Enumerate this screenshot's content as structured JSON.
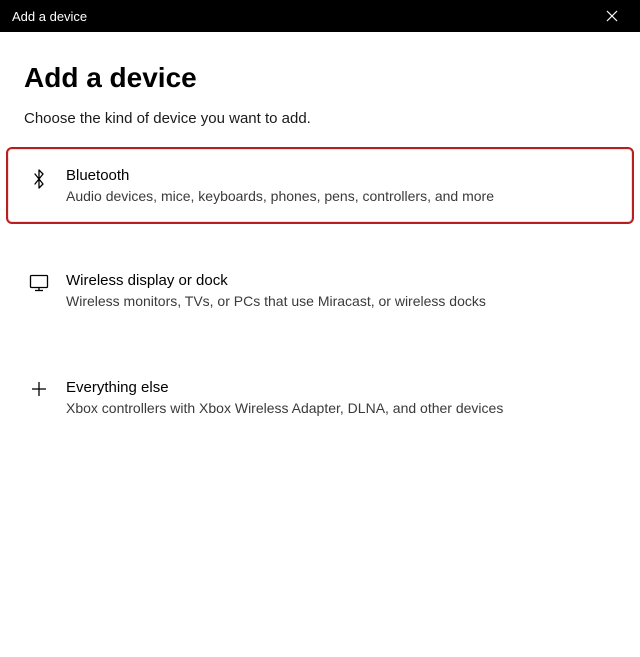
{
  "titlebar": {
    "title": "Add a device"
  },
  "page": {
    "heading": "Add a device",
    "subheading": "Choose the kind of device you want to add."
  },
  "options": [
    {
      "id": "bluetooth",
      "title": "Bluetooth",
      "description": "Audio devices, mice, keyboards, phones, pens, controllers, and more",
      "highlighted": true,
      "icon": "bluetooth-icon"
    },
    {
      "id": "wireless-display",
      "title": "Wireless display or dock",
      "description": "Wireless monitors, TVs, or PCs that use Miracast, or wireless docks",
      "highlighted": false,
      "icon": "display-icon"
    },
    {
      "id": "everything-else",
      "title": "Everything else",
      "description": "Xbox controllers with Xbox Wireless Adapter, DLNA, and other devices",
      "highlighted": false,
      "icon": "plus-icon"
    }
  ],
  "colors": {
    "highlight_border": "#b81e1e",
    "titlebar_bg": "#000000",
    "titlebar_fg": "#ffffff"
  }
}
